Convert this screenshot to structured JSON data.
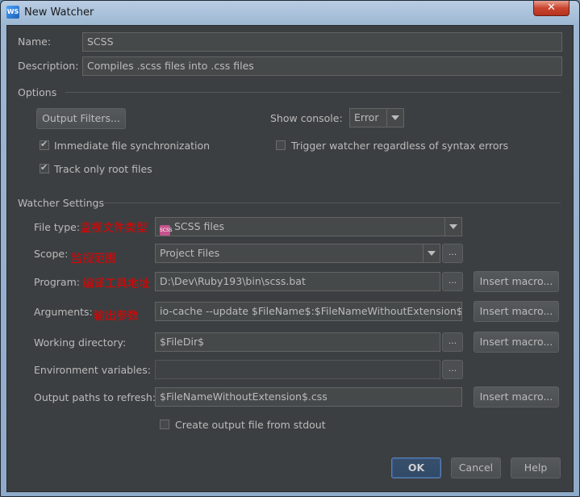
{
  "window": {
    "title": "New Watcher",
    "app_icon": "WS",
    "close_glyph": "✕"
  },
  "form": {
    "name_label": "Name:",
    "name_value": "SCSS",
    "description_label": "Description:",
    "description_value": "Compiles .scss files into .css files"
  },
  "options": {
    "section_label": "Options",
    "output_filters_label": "Output Filters...",
    "show_console_label": "Show console:",
    "show_console_value": "Error",
    "immediate_sync_label": "Immediate file synchronization",
    "immediate_sync_checked": true,
    "track_root_label": "Track only root files",
    "track_root_checked": true,
    "trigger_label": "Trigger watcher regardless of syntax errors",
    "trigger_checked": false
  },
  "watcher": {
    "section_label": "Watcher Settings",
    "file_type_label": "File type:",
    "file_type_value": "SCSS files",
    "file_type_icon_text": "SCSS",
    "scope_label": "Scope:",
    "scope_value": "Project Files",
    "program_label": "Program:",
    "program_value": "D:\\Dev\\Ruby193\\bin\\scss.bat",
    "arguments_label": "Arguments:",
    "arguments_value": "io-cache --update $FileName$:$FileNameWithoutExtension$.css",
    "working_dir_label": "Working directory:",
    "working_dir_value": "$FileDir$",
    "env_vars_label": "Environment variables:",
    "env_vars_value": "",
    "output_paths_label": "Output paths to refresh:",
    "output_paths_value": "$FileNameWithoutExtension$.css",
    "create_output_label": "Create output file from stdout",
    "create_output_checked": false,
    "insert_macro_label": "Insert macro...",
    "ellipsis_label": "..."
  },
  "annotations": {
    "file_type": "监视文件类型",
    "scope": "监视范围",
    "program": "编译工具地址",
    "arguments": "输出参数"
  },
  "footer": {
    "ok_label": "OK",
    "cancel_label": "Cancel",
    "help_label": "Help"
  },
  "colors": {
    "background": "#3c3f41",
    "text": "#bbbbbb",
    "annotation": "#e60000"
  }
}
